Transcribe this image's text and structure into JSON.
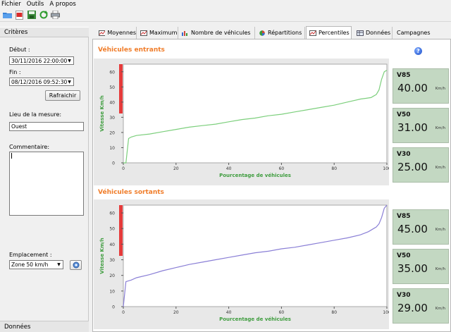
{
  "menu": [
    "Fichier",
    "Outils",
    "A propos"
  ],
  "toolbar_icons": [
    "folder-icon",
    "pdf-icon",
    "save-icon",
    "refresh-icon",
    "print-icon"
  ],
  "left": {
    "header": "Critères",
    "debut_label": "Début :",
    "debut_value": "30/11/2016 22:00:00",
    "fin_label": "Fin :",
    "fin_value": "08/12/2016 09:52:30",
    "refresh_label": "Rafraichir",
    "lieu_label": "Lieu de la mesure:",
    "lieu_value": "Ouest",
    "commentaire_label": "Commentaire:",
    "commentaire_value": "",
    "emplacement_label": "Emplacement :",
    "emplacement_value": "Zone 50 km/h",
    "footer": "Données"
  },
  "tabs": [
    {
      "label": "Moyennes",
      "active": false
    },
    {
      "label": "Maximum",
      "active": false
    },
    {
      "label": "Nombre de véhicules",
      "active": false
    },
    {
      "label": "Répartitions",
      "active": false
    },
    {
      "label": "Percentiles",
      "active": true
    },
    {
      "label": "Données",
      "active": false
    },
    {
      "label": "Campagnes",
      "active": false
    }
  ],
  "colors": {
    "accent": "#f07d2a",
    "line_in": "#7ccf7c",
    "line_out": "#8a7fd6",
    "red_bar": "#e63b3b",
    "value_box": "#c3d8c2"
  },
  "chart_data": [
    {
      "type": "line",
      "title": "Véhicules entrants",
      "xlabel": "Pourcentage de véhicules",
      "ylabel": "Vitesse Km/h",
      "xlim": [
        0,
        100
      ],
      "ylim": [
        0,
        65
      ],
      "xticks": [
        0,
        20,
        40,
        60,
        80,
        100
      ],
      "yticks": [
        0,
        10,
        20,
        30,
        40,
        50,
        60
      ],
      "series": [
        {
          "x": [
            0,
            1,
            2,
            3,
            5,
            10,
            15,
            20,
            25,
            30,
            35,
            40,
            45,
            50,
            55,
            60,
            65,
            70,
            75,
            80,
            85,
            90,
            92,
            94,
            95,
            96,
            97,
            98,
            99,
            100
          ],
          "y": [
            0,
            0,
            16,
            17,
            18,
            19,
            20.5,
            22,
            23.5,
            24.5,
            25.5,
            27,
            28.5,
            29.5,
            31,
            32,
            33.5,
            35,
            36.5,
            38,
            40,
            42,
            42.5,
            43,
            44,
            45,
            48,
            55,
            60,
            61
          ]
        }
      ],
      "values": [
        {
          "name": "V85",
          "value": "40.00",
          "unit": "Km/h"
        },
        {
          "name": "V50",
          "value": "31.00",
          "unit": "Km/h"
        },
        {
          "name": "V30",
          "value": "25.00",
          "unit": "Km/h"
        }
      ]
    },
    {
      "type": "line",
      "title": "Véhicules sortants",
      "xlabel": "Pourcentage de véhicules",
      "ylabel": "Vitesse Km/h",
      "xlim": [
        0,
        100
      ],
      "ylim": [
        0,
        65
      ],
      "xticks": [
        0,
        20,
        40,
        60,
        80,
        100
      ],
      "yticks": [
        0,
        10,
        20,
        30,
        40,
        50,
        60
      ],
      "series": [
        {
          "x": [
            0,
            1,
            3,
            5,
            10,
            15,
            20,
            25,
            30,
            35,
            40,
            45,
            50,
            55,
            60,
            65,
            70,
            75,
            80,
            85,
            90,
            93,
            95,
            96,
            97,
            98,
            99,
            100
          ],
          "y": [
            0,
            16,
            17,
            18.5,
            20.5,
            23,
            25,
            27,
            28.5,
            30,
            31.5,
            33,
            34.5,
            35.5,
            37,
            38,
            39.5,
            41,
            42.5,
            44,
            46,
            48,
            50,
            51,
            53,
            57,
            63,
            65
          ]
        }
      ],
      "values": [
        {
          "name": "V85",
          "value": "45.00",
          "unit": "Km/h"
        },
        {
          "name": "V50",
          "value": "35.00",
          "unit": "Km/h"
        },
        {
          "name": "V30",
          "value": "29.00",
          "unit": "Km/h"
        }
      ]
    }
  ]
}
